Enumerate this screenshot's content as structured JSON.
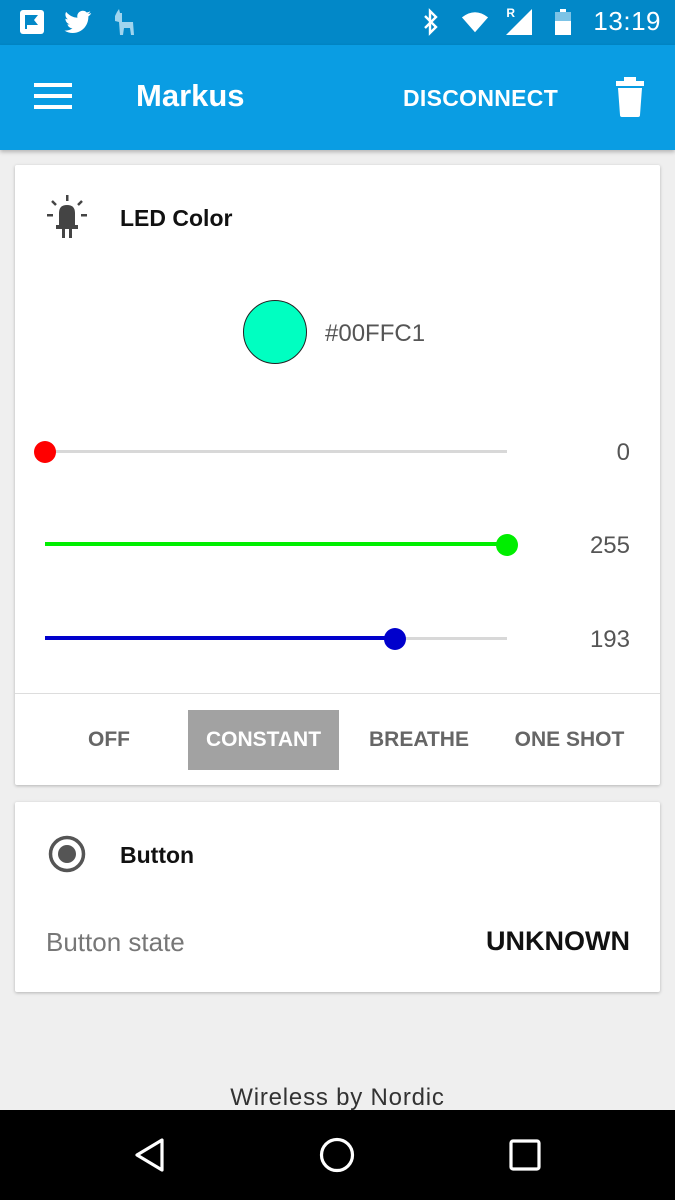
{
  "status_bar": {
    "time": "13:19",
    "left_icons": [
      "flag-notification-icon",
      "twitter-icon",
      "llama-icon"
    ],
    "right_icons": [
      "bluetooth-icon",
      "wifi-icon",
      "cell-signal-roaming-icon",
      "battery-icon"
    ],
    "roaming_badge": "R"
  },
  "app_bar": {
    "title": "Markus",
    "disconnect_label": "DISCONNECT",
    "color": "#0a9de3"
  },
  "led_card": {
    "title": "LED Color",
    "icon": "led-icon",
    "color_hex": "#00FFC1",
    "swatch_color": "#00ffc1",
    "sliders": [
      {
        "name": "red",
        "value": "0",
        "fraction": 0.0,
        "color": "#ff0000"
      },
      {
        "name": "green",
        "value": "255",
        "fraction": 1.0,
        "color": "#00ee00"
      },
      {
        "name": "blue",
        "value": "193",
        "fraction": 0.757,
        "color": "#0000cc"
      }
    ],
    "modes": [
      {
        "label": "OFF",
        "active": false
      },
      {
        "label": "CONSTANT",
        "active": true
      },
      {
        "label": "BREATHE",
        "active": false
      },
      {
        "label": "ONE SHOT",
        "active": false
      }
    ]
  },
  "button_card": {
    "title": "Button",
    "icon": "radio-button-icon",
    "state_label": "Button state",
    "state_value": "UNKNOWN"
  },
  "footer": {
    "text": "Wireless by Nordic"
  },
  "nav_bar": {
    "buttons": [
      "back-icon",
      "home-icon",
      "recents-icon"
    ]
  }
}
